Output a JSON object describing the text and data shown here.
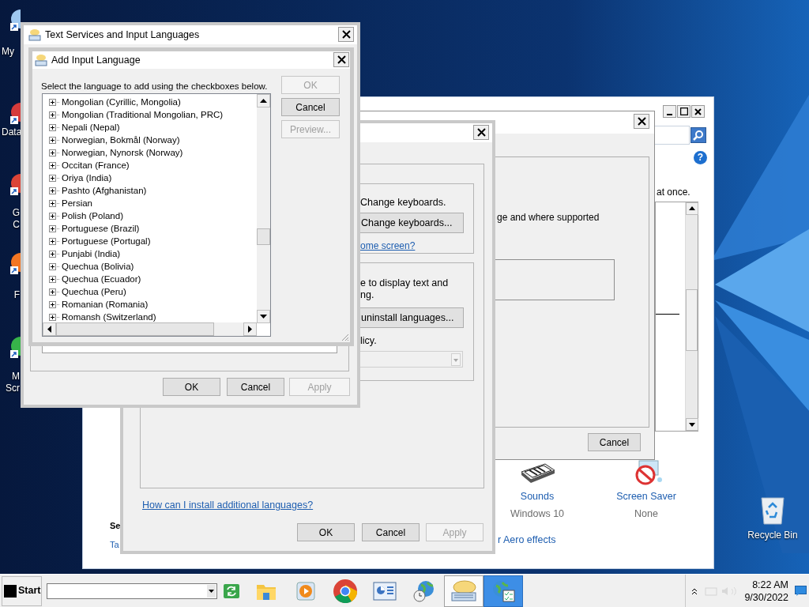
{
  "desktop": {
    "icons": [
      {
        "kind": "computer",
        "lines": [
          "My"
        ]
      },
      {
        "kind": "data",
        "lines": [
          "Data"
        ]
      },
      {
        "kind": "chrome",
        "lines": [
          "G",
          "C"
        ]
      },
      {
        "kind": "firefox",
        "lines": [
          "F"
        ]
      },
      {
        "kind": "green",
        "lines": [
          "M",
          "Scr"
        ]
      }
    ],
    "recycle_bin": {
      "label": "Recycle Bin"
    }
  },
  "control_panel": {
    "help_icon": "?",
    "fragment": "at once.",
    "heading_fragment": "Se",
    "link_fragment": "Ta",
    "aero_link": "r Aero effects",
    "items": [
      {
        "kind": "sounds",
        "title": "Sounds",
        "subtitle": "Windows 10"
      },
      {
        "kind": "screensaver",
        "title": "Screen Saver",
        "subtitle": "None"
      }
    ]
  },
  "region_dialog": {
    "fragment": "ge and where supported",
    "buttons": [
      {
        "label": "Cancel",
        "disabled": false
      }
    ]
  },
  "languages_dialog": {
    "keyboards": {
      "text": "Change keyboards.",
      "button": "Change keyboards...",
      "link": "ome screen?"
    },
    "display": {
      "lines": [
        "e to display text and",
        "ng."
      ],
      "button": "uninstall languages...",
      "text": "licy.",
      "dropdown": {
        "disabled": true
      }
    },
    "help_link": "How can I install additional languages?",
    "buttons": [
      {
        "label": "OK",
        "disabled": false
      },
      {
        "label": "Cancel",
        "disabled": false
      },
      {
        "label": "Apply",
        "disabled": true
      }
    ]
  },
  "text_services": {
    "title": "Text Services and Input Languages",
    "buttons": [
      {
        "label": "OK",
        "disabled": false
      },
      {
        "label": "Cancel",
        "disabled": false
      },
      {
        "label": "Apply",
        "disabled": true
      }
    ]
  },
  "add_input_language": {
    "title": "Add Input Language",
    "instruction": "Select the language to add using the checkboxes below.",
    "buttons": [
      {
        "label": "OK",
        "disabled": true
      },
      {
        "label": "Cancel",
        "disabled": false
      },
      {
        "label": "Preview...",
        "disabled": true
      }
    ],
    "languages": [
      {
        "label": "Mongolian (Cyrillic, Mongolia)",
        "expanded": false
      },
      {
        "label": "Mongolian (Traditional Mongolian, PRC)",
        "expanded": false
      },
      {
        "label": "Nepali (Nepal)",
        "expanded": false
      },
      {
        "label": "Norwegian, Bokmål (Norway)",
        "expanded": false
      },
      {
        "label": "Norwegian, Nynorsk (Norway)",
        "expanded": false
      },
      {
        "label": "Occitan (France)",
        "expanded": false
      },
      {
        "label": "Oriya (India)",
        "expanded": false
      },
      {
        "label": "Pashto (Afghanistan)",
        "expanded": false
      },
      {
        "label": "Persian",
        "expanded": false
      },
      {
        "label": "Polish (Poland)",
        "expanded": false
      },
      {
        "label": "Portuguese (Brazil)",
        "expanded": false
      },
      {
        "label": "Portuguese (Portugal)",
        "expanded": false
      },
      {
        "label": "Punjabi (India)",
        "expanded": false
      },
      {
        "label": "Quechua (Bolivia)",
        "expanded": false
      },
      {
        "label": "Quechua (Ecuador)",
        "expanded": false
      },
      {
        "label": "Quechua (Peru)",
        "expanded": false
      },
      {
        "label": "Romanian (Romania)",
        "expanded": false
      },
      {
        "label": "Romansh (Switzerland)",
        "expanded": false
      }
    ]
  },
  "taskbar": {
    "start": "Start",
    "apps": [
      {
        "kind": "folder",
        "pressed": false,
        "selected": false
      },
      {
        "kind": "media",
        "pressed": false,
        "selected": false
      },
      {
        "kind": "chrome",
        "pressed": false,
        "selected": false
      },
      {
        "kind": "presentation",
        "pressed": false,
        "selected": false
      },
      {
        "kind": "globe_clock",
        "pressed": false,
        "selected": false
      },
      {
        "kind": "keyboard",
        "pressed": true,
        "selected": false
      },
      {
        "kind": "globe_checklist",
        "pressed": false,
        "selected": true
      }
    ],
    "time": "8:22 AM",
    "date": "9/30/2022"
  }
}
